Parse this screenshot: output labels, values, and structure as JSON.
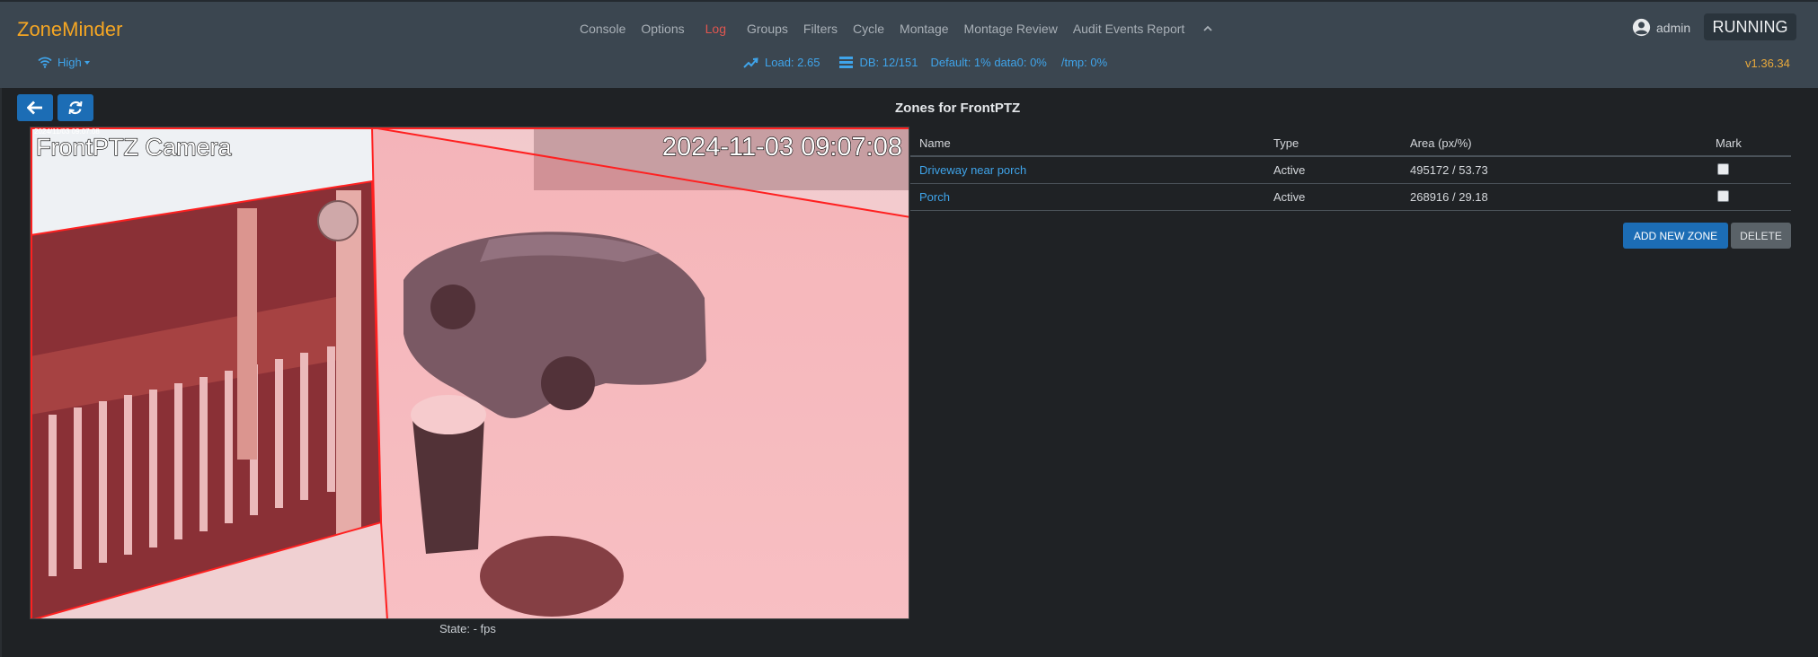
{
  "header": {
    "brand": "ZoneMinder",
    "nav": [
      "Console",
      "Options",
      "Log",
      "Groups",
      "Filters",
      "Cycle",
      "Montage",
      "Montage Review",
      "Audit Events Report"
    ],
    "active_nav": "Log",
    "user": "admin",
    "status": "RUNNING",
    "bandwidth": "High",
    "load": "Load: 2.65",
    "db": "DB: 12/151",
    "disk": "Default: 1% data0: 0%",
    "tmp": "/tmp: 0%",
    "version": "v1.36.34"
  },
  "page": {
    "title": "Zones for FrontPTZ",
    "state": "State:  -  fps"
  },
  "camera": {
    "overlay_title": "FrontPTZ Camera",
    "overlay_small": "2024/11/03 09:07:08",
    "timestamp": "2024-11-03 09:07:08"
  },
  "zones": {
    "columns": {
      "name": "Name",
      "type": "Type",
      "area": "Area (px/%)",
      "mark": "Mark"
    },
    "rows": [
      {
        "name": "Driveway near porch",
        "type": "Active",
        "area": "495172 / 53.73"
      },
      {
        "name": "Porch",
        "type": "Active",
        "area": "268916 / 29.18"
      }
    ]
  },
  "actions": {
    "add": "ADD NEW ZONE",
    "delete": "DELETE"
  },
  "colors": {
    "brand": "#f5a623",
    "link": "#3fa4ea",
    "primary": "#1c6db5",
    "active_nav": "#e0564f",
    "zone_line": "#ff2020"
  }
}
